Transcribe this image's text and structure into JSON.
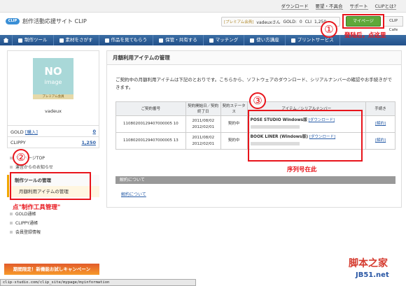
{
  "top_links": [
    "ダウンロード",
    "要望・不具合",
    "サポート",
    "CLIPとは?"
  ],
  "header": {
    "logo_badge": "CLIP",
    "site_title": "創作活動応援サイト CLIP",
    "premium_tag": "[プレミアム会員]",
    "username": "vadeuxさん",
    "gold_label": "GOLD:",
    "gold_value": "0",
    "clip_label": "CLI",
    "clip_value": "1,250",
    "mypage_btn": "マイページ",
    "clip_btn": "CLIP Cafe"
  },
  "nav": [
    "制作ツール",
    "素材をさがす",
    "作品を見てもらう",
    "保管・共有する",
    "マッチング",
    "使い方講座",
    "プリントサービス"
  ],
  "sidebar": {
    "avatar_line1": "NO",
    "avatar_line2": "image",
    "premium_strip": "プレミアム会員",
    "name": "vadeux",
    "gold_label": "GOLD",
    "gold_buy": "[購入]",
    "gold_value": "0",
    "clippy_label": "CLIPPY",
    "clippy_value": "1,250",
    "links_top": [
      "マイページTOP",
      "運営からのお知らせ"
    ],
    "cat": "制作ツールの管理",
    "sub": "月額利用アイテムの管理",
    "links_bottom": [
      "GOLD通帳",
      "CLIPPY通帳",
      "会員登録情報"
    ],
    "banner": "期間限定！新機能お試しキャンペーン"
  },
  "statusbar": "clip-studio.com/clip_site/mypage/myinformation",
  "main": {
    "title": "月額利用アイテムの管理",
    "desc": "ご契約中の月額利用アイテムは下記のとおりです。こちらから、ソフトウェアのダウンロード、シリアルナンバーの確認やお手続きができます。",
    "headers": [
      "ご契約番号",
      "契約開始日／契約終了日",
      "契約ステータス",
      "アイテム／シリアルナンバー",
      "手続き"
    ],
    "rows": [
      {
        "id": "11080200129407000005 10",
        "start": "2011/08/02",
        "end": "2012/02/01",
        "status": "契約中",
        "product": "POSE STUDIO Windows版",
        "dl": "[ダウンロード]",
        "action": "[解約]"
      },
      {
        "id": "11080200129407000005 13",
        "start": "2011/08/02",
        "end": "2012/02/01",
        "status": "契約中",
        "product": "BOOK LINER (Windows版)",
        "dl": "[ダウンロード]",
        "action": "[解約]"
      }
    ],
    "fees_bar": "解約について",
    "fees_link": "解約について"
  },
  "annotations": {
    "n1": "①",
    "n2": "②",
    "n3": "③",
    "a1": "登陆后，点这里",
    "a2": "点\"制作工具管理\"",
    "a3": "序列号在此"
  },
  "watermark": {
    "line1": "脚本之家",
    "line2": "JB51.net"
  },
  "colors": {
    "accent": "#e8141b",
    "nav": "#2d5f98",
    "mypage": "#5fa83a"
  }
}
